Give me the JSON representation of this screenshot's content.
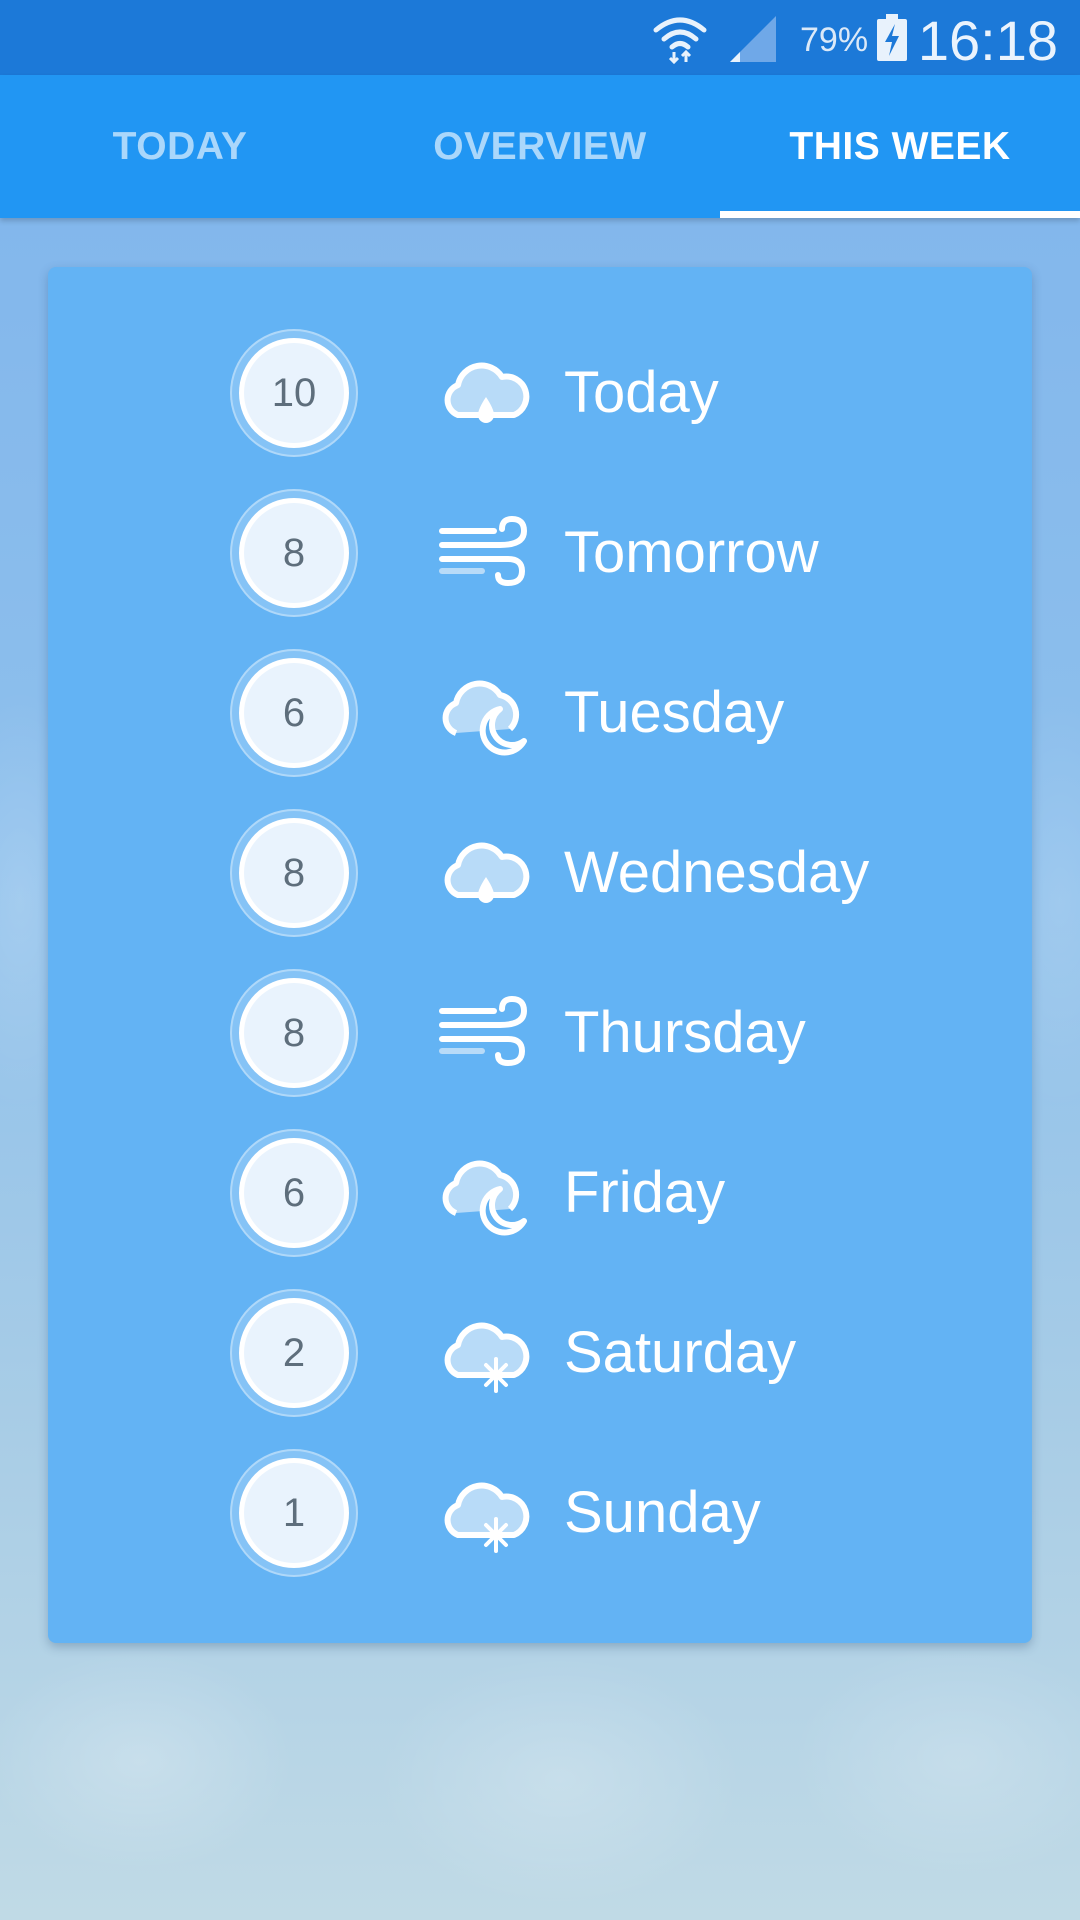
{
  "status_bar": {
    "battery_percent": "79%",
    "time": "16:18",
    "icons": [
      "wifi-icon",
      "signal-icon",
      "battery-charging-icon"
    ]
  },
  "tabs": [
    {
      "label": "TODAY",
      "active": false
    },
    {
      "label": "OVERVIEW",
      "active": false
    },
    {
      "label": "THIS WEEK",
      "active": true
    }
  ],
  "week": [
    {
      "value": "10",
      "icon": "cloud-rain-icon",
      "day": "Today"
    },
    {
      "value": "8",
      "icon": "wind-icon",
      "day": "Tomorrow"
    },
    {
      "value": "6",
      "icon": "cloud-moon-icon",
      "day": "Tuesday"
    },
    {
      "value": "8",
      "icon": "cloud-rain-icon",
      "day": "Wednesday"
    },
    {
      "value": "8",
      "icon": "wind-icon",
      "day": "Thursday"
    },
    {
      "value": "6",
      "icon": "cloud-moon-icon",
      "day": "Friday"
    },
    {
      "value": "2",
      "icon": "cloud-snow-icon",
      "day": "Saturday"
    },
    {
      "value": "1",
      "icon": "cloud-snow-icon",
      "day": "Sunday"
    }
  ],
  "colors": {
    "status_bar": "#1c79d8",
    "tab_bar": "#2196f3",
    "card": "#63b3f4"
  }
}
